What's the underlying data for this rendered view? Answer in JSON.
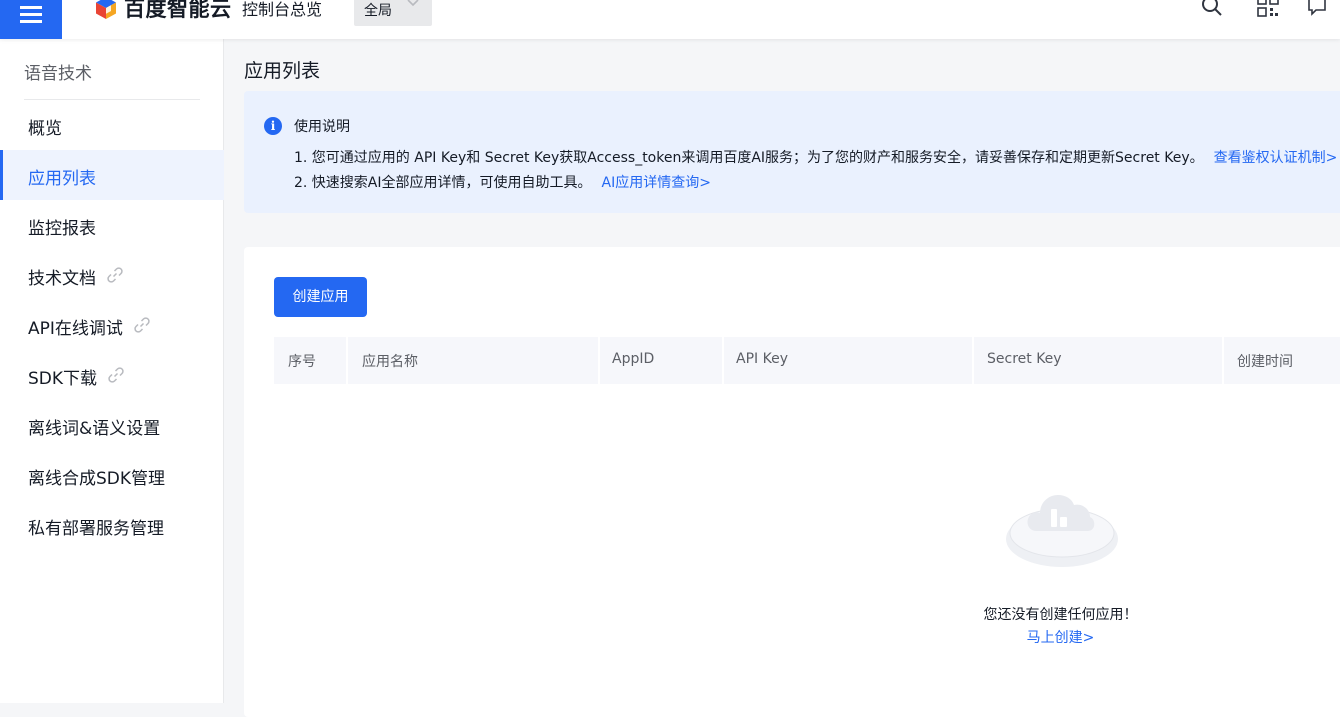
{
  "header": {
    "brand": "百度智能云",
    "console_title": "控制台总览",
    "scope_label": "全局"
  },
  "sidebar": {
    "title": "语音技术",
    "items": [
      {
        "label": "概览",
        "external": false,
        "active": false
      },
      {
        "label": "应用列表",
        "external": false,
        "active": true
      },
      {
        "label": "监控报表",
        "external": false,
        "active": false
      },
      {
        "label": "技术文档",
        "external": true,
        "active": false
      },
      {
        "label": "API在线调试",
        "external": true,
        "active": false
      },
      {
        "label": "SDK下载",
        "external": true,
        "active": false
      },
      {
        "label": "离线词&语义设置",
        "external": false,
        "active": false
      },
      {
        "label": "离线合成SDK管理",
        "external": false,
        "active": false
      },
      {
        "label": "私有部署服务管理",
        "external": false,
        "active": false
      }
    ]
  },
  "main": {
    "page_title": "应用列表",
    "notice": {
      "title": "使用说明",
      "line1": "1. 您可通过应用的 API Key和 Secret Key获取Access_token来调用百度AI服务；为了您的财产和服务安全，请妥善保存和定期更新Secret Key。",
      "line1_link": "查看鉴权认证机制>",
      "line2": "2. 快速搜索AI全部应用详情，可使用自助工具。",
      "line2_link": "AI应用详情查询>"
    },
    "create_button": "创建应用",
    "table": {
      "columns": [
        "序号",
        "应用名称",
        "AppID",
        "API Key",
        "Secret Key",
        "创建时间"
      ]
    },
    "empty": {
      "message": "您还没有创建任何应用！",
      "action": "马上创建>"
    }
  },
  "colors": {
    "primary": "#2468f2",
    "notice_bg": "#eaf1fe",
    "active_bg": "#eef3fe"
  }
}
